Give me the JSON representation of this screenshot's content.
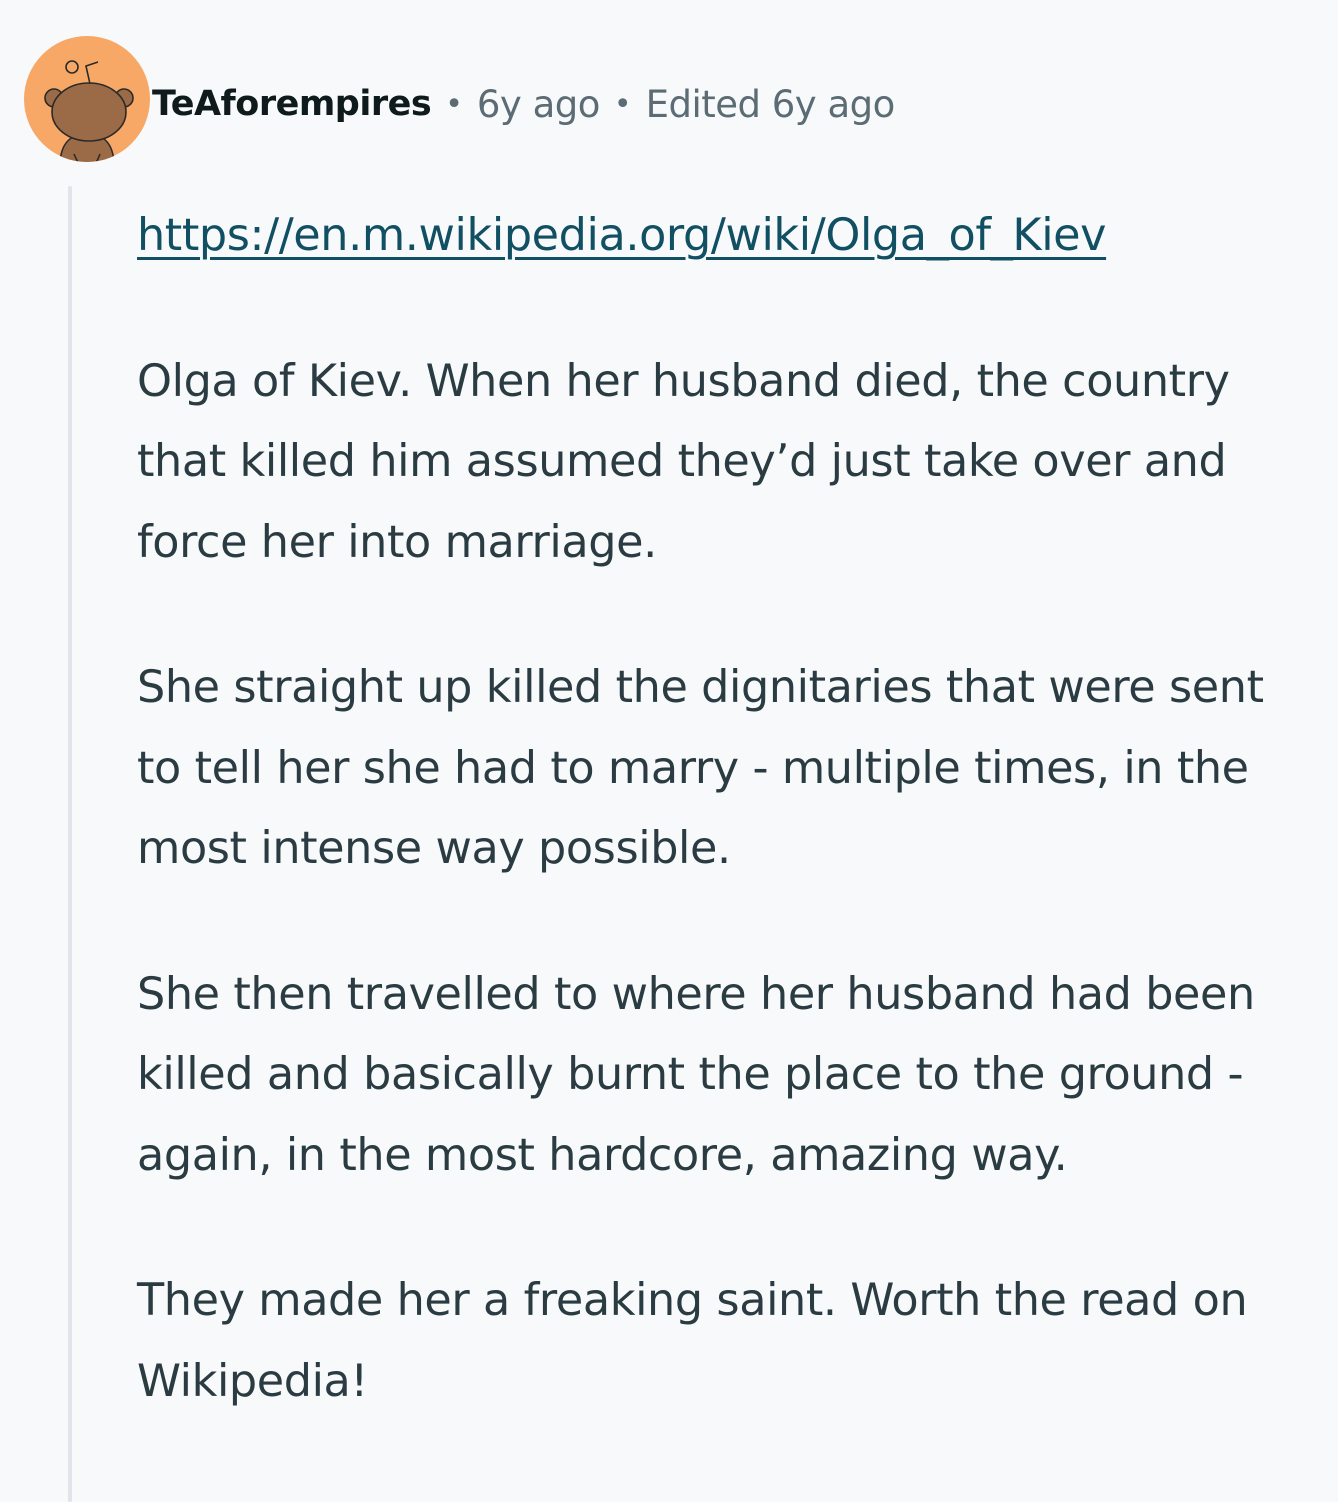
{
  "comment": {
    "username": "TeAforempires",
    "separator": "•",
    "posted": "6y ago",
    "edited": "Edited 6y ago",
    "avatar_icon": "snoo-avatar-icon",
    "link": "https://en.m.wikipedia.org/wiki/Olga_of_Kiev",
    "paragraphs": [
      "Olga of Kiev. When her husband died, the country that killed him assumed they’d just take over and force her into marriage.",
      "She straight up killed the dignitaries that were sent to tell her she had to marry - multiple times, in the most intense way possible.",
      "She then travelled to where her husband had been killed and basically burnt the place to the ground - again, in the most hardcore, amazing way.",
      "They made her a freaking saint. Worth the read on Wikipedia!"
    ]
  },
  "colors": {
    "background": "#f7f9fb",
    "avatar_bg": "#f7a866",
    "link": "#114f63",
    "text": "#2a3c42",
    "meta": "#5c6c74",
    "thread_line": "#dfe5ea"
  }
}
